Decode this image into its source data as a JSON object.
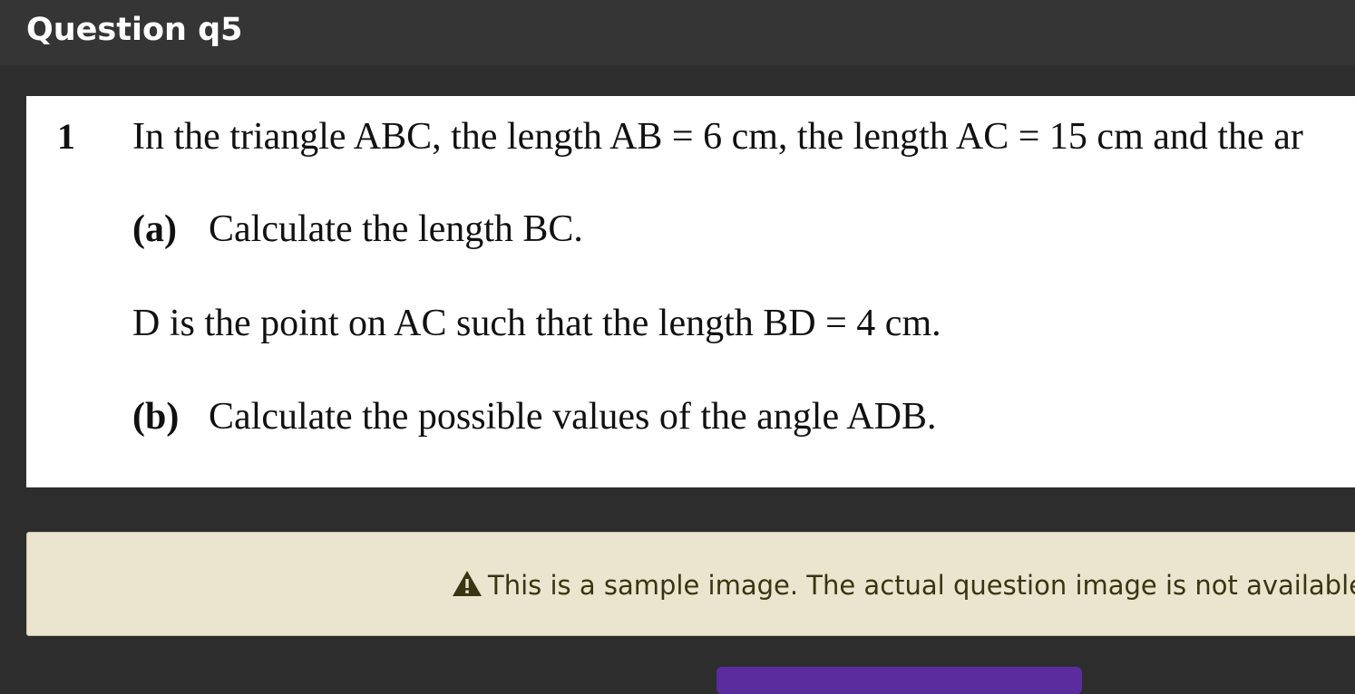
{
  "header": {
    "title": "Question q5"
  },
  "question": {
    "number": "1",
    "intro": "In the triangle ABC, the length AB = 6 cm, the length AC = 15 cm and the ar",
    "part_a_label": "(a)",
    "part_a_text": "Calculate the length BC.",
    "point_d_text": "D is the point on AC such that the length BD = 4 cm.",
    "part_b_label": "(b)",
    "part_b_text": "Calculate the possible values of the angle ADB."
  },
  "notice": {
    "icon": "warning-icon",
    "text": "This is a sample image. The actual question image is not available."
  },
  "colors": {
    "background": "#2d2d2d",
    "header": "#353535",
    "notice_bg": "#ebe5cf",
    "notice_text": "#3a3412",
    "button": "#5b2c9e"
  }
}
